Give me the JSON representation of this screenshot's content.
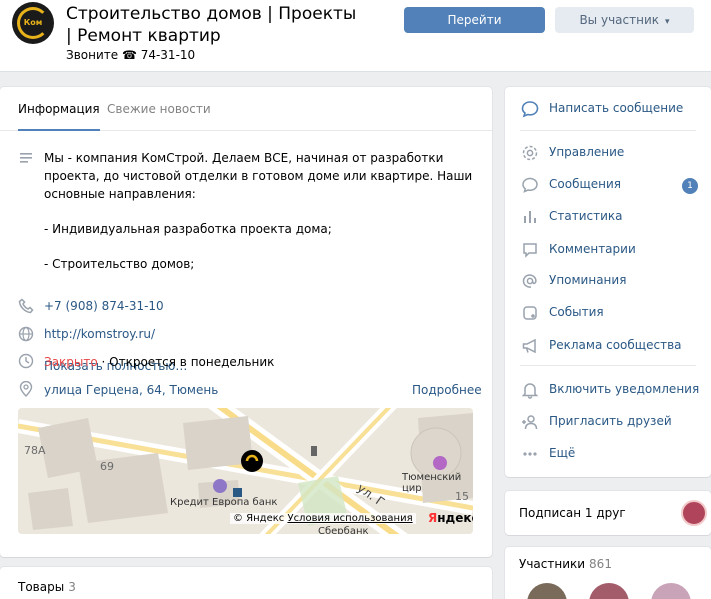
{
  "header": {
    "title": "Строительство домов | Проекты | Ремонт квартир",
    "status": "Звоните ☎ 74-31-10",
    "logo_text": "Ком",
    "primary_button": "Перейти",
    "member_button": "Вы участник"
  },
  "tabs": [
    {
      "label": "Информация",
      "active": true
    },
    {
      "label": "Свежие новости",
      "active": false
    }
  ],
  "info": {
    "description": [
      "Мы - компания КомСтрой. Делаем ВСЕ, начиная от разработки проекта, до чистовой отделки в готовом доме или квартире. Наши основные направления:",
      "- Индивидуальная разработка проекта дома;",
      "- Строительство домов;"
    ],
    "more": "Показать полностью…",
    "phone": "+7 (908) 874-31-10",
    "website": "http://komstroy.ru/",
    "hours_status": "Закрыто",
    "hours_note": " · Откроется в понедельник",
    "address": "улица Герцена, 64, Тюмень",
    "address_more": "Подробнее"
  },
  "map": {
    "labels": {
      "house_78a": "78А",
      "house_69": "69",
      "house_15": "15",
      "bank": "Кредит Европа банк",
      "sberbank": "Сбербанк",
      "street": "ул. Г",
      "tyumen": "Тюменский цир"
    },
    "copyright_prefix": "© Яндекс",
    "terms": "Условия использования",
    "brand_y": "Я",
    "brand_rest": "ндекс"
  },
  "goods": {
    "title": "Товары",
    "count": "3"
  },
  "menu": [
    {
      "label": "Написать сообщение",
      "icon": "message-icon"
    },
    {
      "label": "Управление",
      "icon": "gear-icon"
    },
    {
      "label": "Сообщения",
      "icon": "chat-icon",
      "badge": "1"
    },
    {
      "label": "Статистика",
      "icon": "stats-icon"
    },
    {
      "label": "Комментарии",
      "icon": "comment-icon"
    },
    {
      "label": "Упоминания",
      "icon": "at-icon"
    },
    {
      "label": "События",
      "icon": "events-icon"
    },
    {
      "label": "Реклама сообщества",
      "icon": "megaphone-icon"
    },
    {
      "label": "Включить уведомления",
      "icon": "bell-icon"
    },
    {
      "label": "Пригласить друзей",
      "icon": "add-user-icon"
    },
    {
      "label": "Ещё",
      "icon": "more-icon"
    }
  ],
  "subscribed": {
    "label": "Подписан 1 друг"
  },
  "members": {
    "title": "Участники",
    "count": "861"
  },
  "colors": {
    "accent": "#5181b8",
    "link": "#2a5885",
    "closed": "#e64646",
    "background": "#edeef0"
  }
}
